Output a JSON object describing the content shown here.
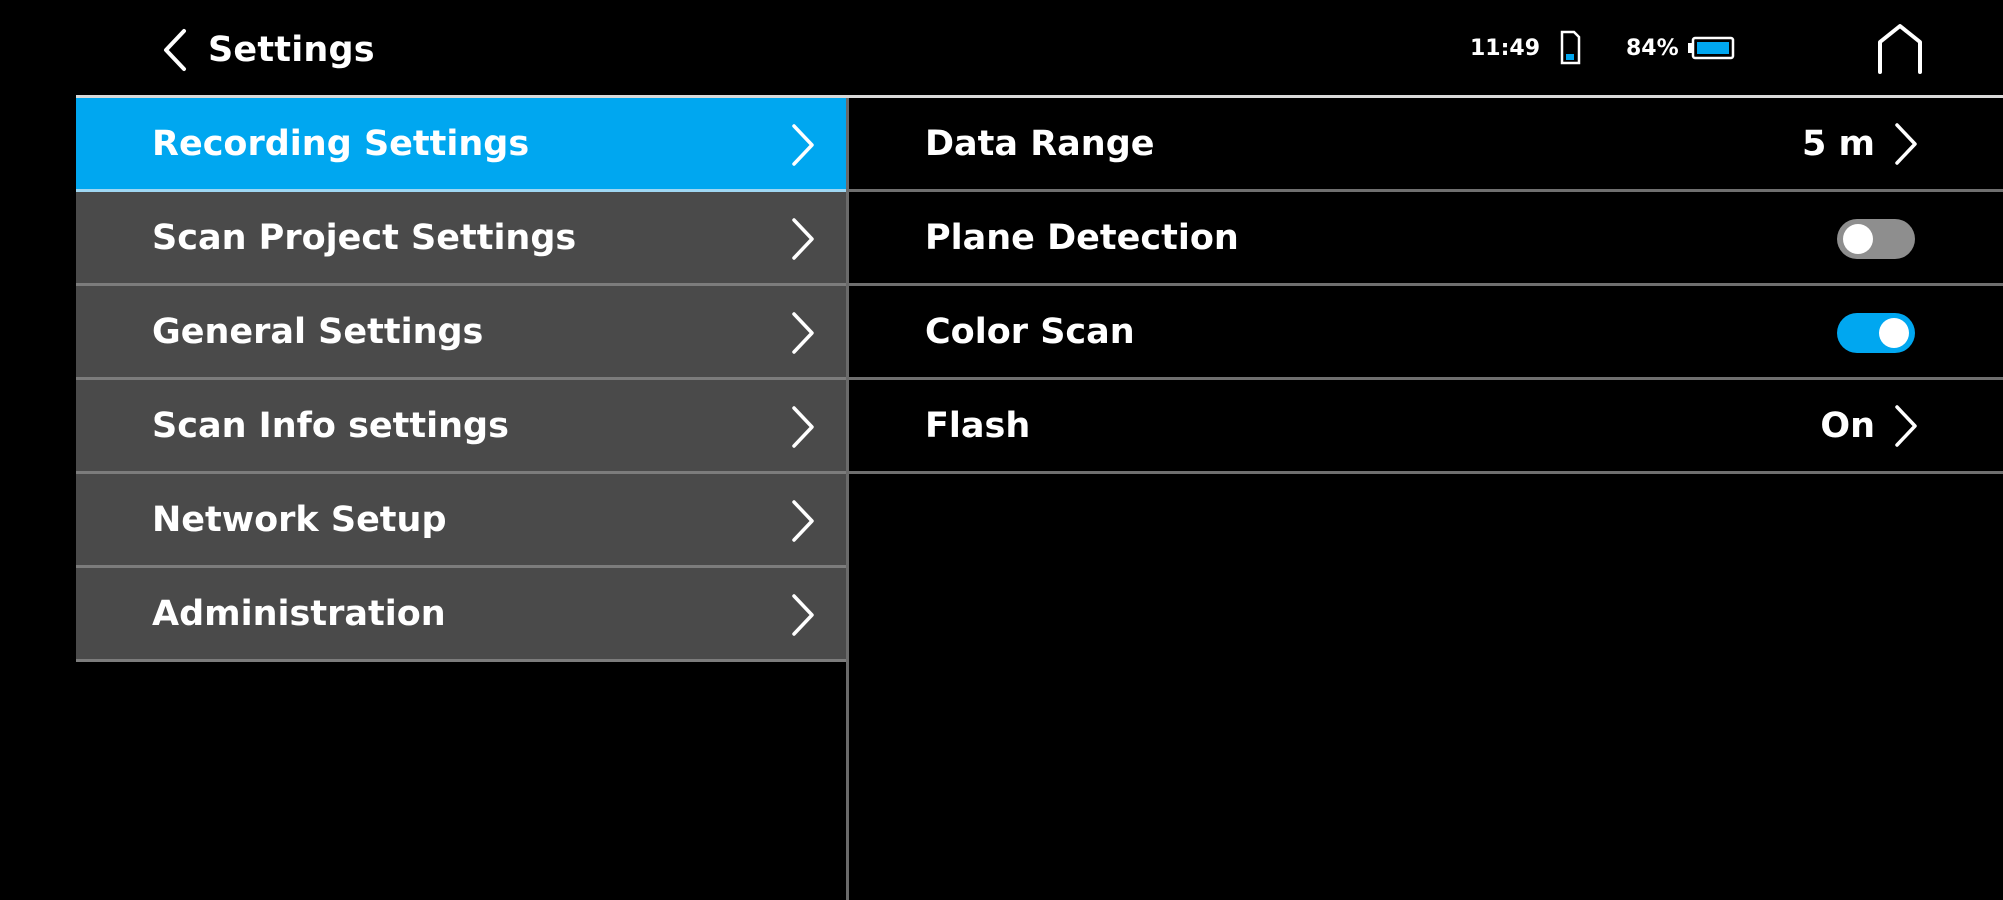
{
  "header": {
    "title": "Settings",
    "time": "11:49",
    "battery": "84%"
  },
  "menu": {
    "items": [
      {
        "label": "Recording Settings",
        "active": true
      },
      {
        "label": "Scan Project Settings",
        "active": false
      },
      {
        "label": "General Settings",
        "active": false
      },
      {
        "label": "Scan Info settings",
        "active": false
      },
      {
        "label": "Network Setup",
        "active": false
      },
      {
        "label": "Administration",
        "active": false
      }
    ]
  },
  "details": {
    "data_range": {
      "label": "Data Range",
      "value": "5 m"
    },
    "plane_detection": {
      "label": "Plane Detection",
      "enabled": false
    },
    "color_scan": {
      "label": "Color Scan",
      "enabled": true
    },
    "flash": {
      "label": "Flash",
      "value": "On"
    }
  },
  "colors": {
    "accent": "#00a7f0",
    "menu_bg": "#4a4a4a",
    "background": "#000000",
    "toggle_off": "#8e8e8e"
  },
  "icons": [
    "back-arrow-icon",
    "storage-card-icon",
    "battery-icon",
    "home-icon",
    "chevron-right-icon"
  ]
}
